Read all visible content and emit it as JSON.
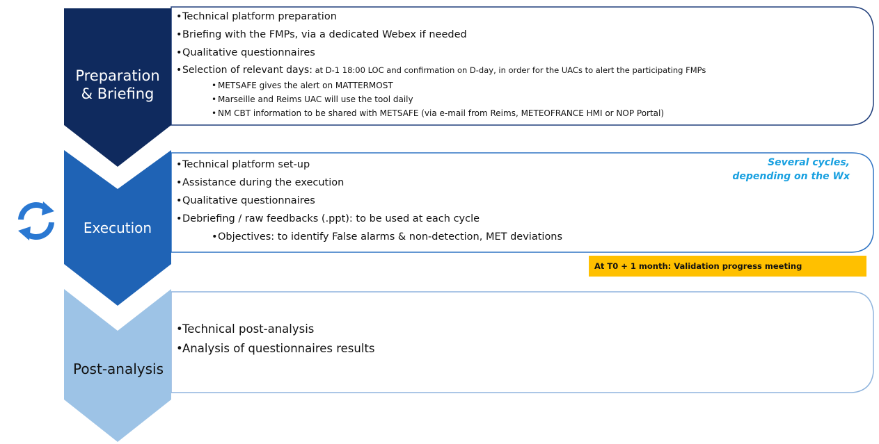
{
  "stages": [
    {
      "label_line1": "Preparation",
      "label_line2": "& Briefing",
      "color": "#0f2a5e",
      "items": [
        {
          "text": "Technical platform preparation",
          "level": 1
        },
        {
          "text": "Briefing with the FMPs, via a dedicated Webex if needed",
          "level": 1
        },
        {
          "text": "Qualitative questionnaires",
          "level": 1
        },
        {
          "text": "Selection of relevant days:",
          "suffix": " at D-1 18:00 LOC and confirmation on D-day, in order for the UACs to alert the participating FMPs",
          "level": 1
        },
        {
          "text": "METSAFE gives the alert on MATTERMOST",
          "level": 2
        },
        {
          "text": "Marseille and Reims UAC will use the tool daily",
          "level": 2
        },
        {
          "text": "NM CBT information to be shared with METSAFE (via e-mail from Reims, METEOFRANCE HMI or NOP Portal)",
          "level": 2
        }
      ]
    },
    {
      "label_line1": "Execution",
      "color": "#1f63b5",
      "items": [
        {
          "text": "Technical platform set-up",
          "level": 1
        },
        {
          "text": "Assistance during the execution",
          "level": 1
        },
        {
          "text": "Qualitative questionnaires",
          "level": 1
        },
        {
          "text": "Debriefing / raw feedbacks (.ppt): to be used at each cycle",
          "level": 1
        },
        {
          "text": "Objectives: to identify False alarms & non-detection, MET deviations",
          "level": 2
        }
      ],
      "note_line1": "Several cycles,",
      "note_line2": "depending on the Wx",
      "cycle_icon": "refresh-cycle-icon"
    },
    {
      "label_line1": "Post-analysis",
      "color": "#9dc3e6",
      "items": [
        {
          "text": "Technical post-analysis",
          "level": 1
        },
        {
          "text": "Analysis of questionnaires results",
          "level": 1
        }
      ]
    }
  ],
  "milestone": {
    "text": "At T0 + 1 month: Validation progress meeting",
    "color": "#ffc000"
  },
  "colors": {
    "box_border_dark": "#1f3d7a",
    "box_border_mid": "#2e74c4",
    "box_border_light": "#8fb4dd",
    "note": "#18a0e0"
  }
}
